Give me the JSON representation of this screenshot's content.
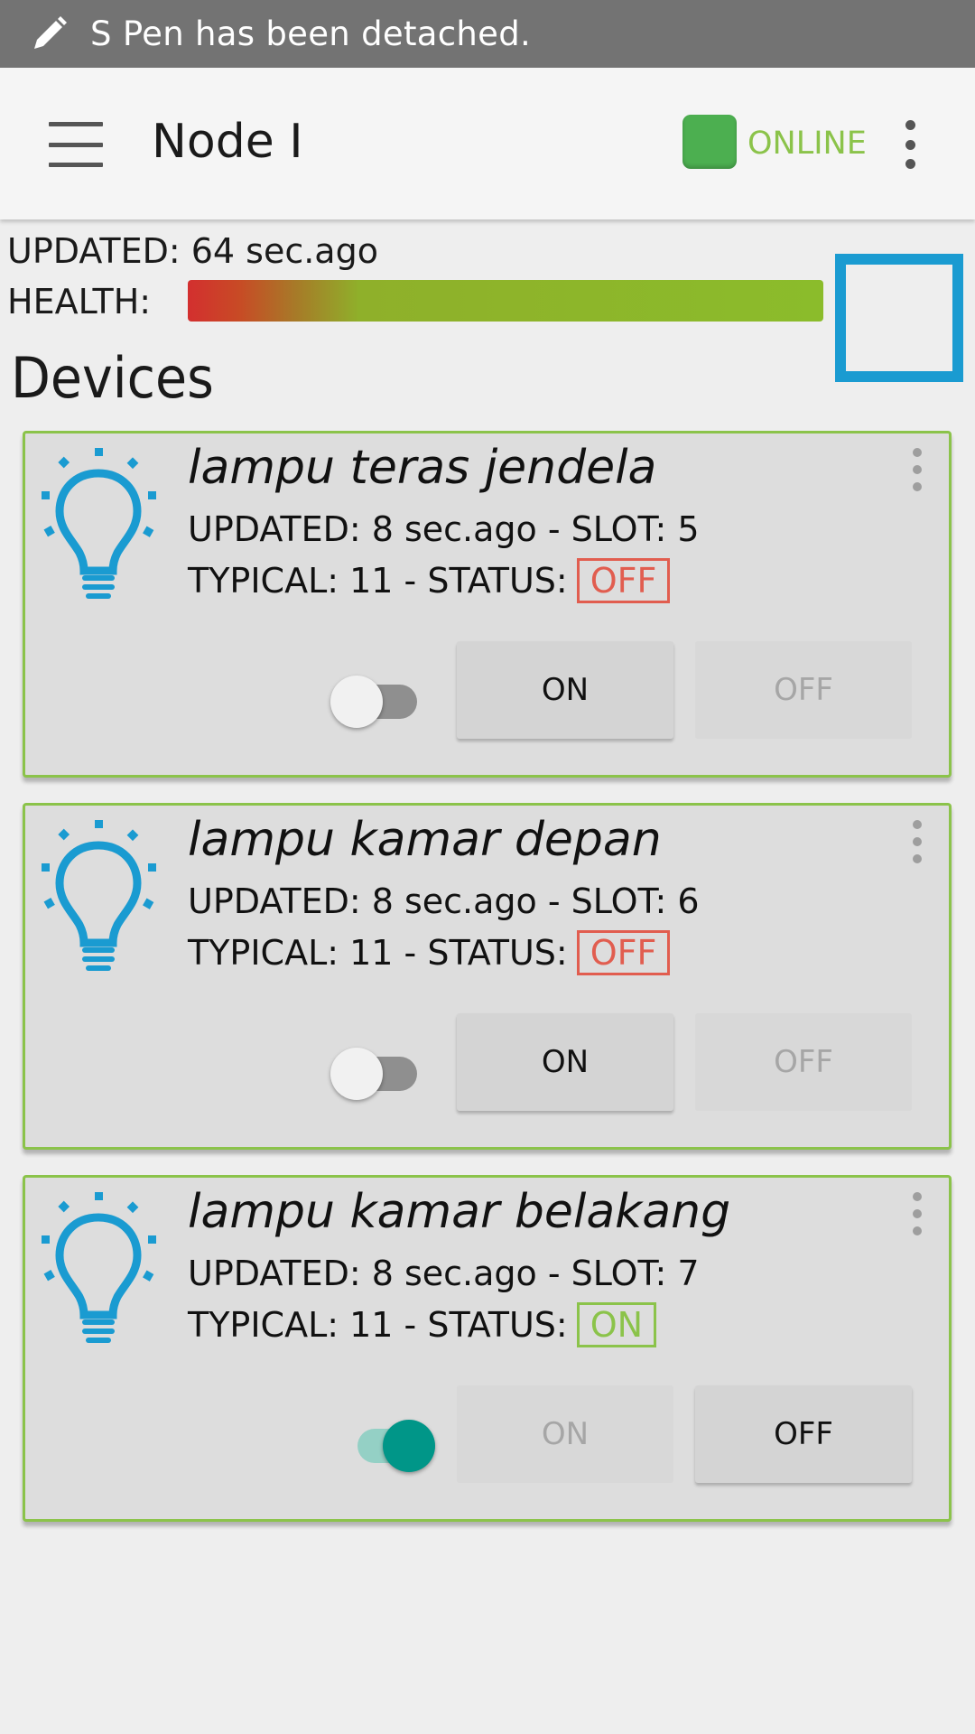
{
  "status_bar": {
    "message": "S Pen has been detached.",
    "icon": "pen-icon"
  },
  "app_bar": {
    "title": "Node I",
    "status_text": "ONLINE",
    "status_color": "#8bc34a",
    "status_indicator_color": "#4caf50"
  },
  "node": {
    "updated": "UPDATED: 64 sec.ago",
    "health_label": "HEALTH:"
  },
  "devices_heading": "Devices",
  "devices": [
    {
      "name": "lampu teras jendela",
      "updated_slot": "UPDATED: 8 sec.ago - SLOT: 5",
      "typical_status": "TYPICAL: 11 - STATUS:",
      "status": "OFF",
      "switch_on": false,
      "on_label": "ON",
      "off_label": "OFF"
    },
    {
      "name": "lampu kamar depan",
      "updated_slot": "UPDATED: 8 sec.ago - SLOT: 6",
      "typical_status": "TYPICAL: 11 - STATUS:",
      "status": "OFF",
      "switch_on": false,
      "on_label": "ON",
      "off_label": "OFF"
    },
    {
      "name": "lampu kamar belakang",
      "updated_slot": "UPDATED: 8 sec.ago - SLOT: 7",
      "typical_status": "TYPICAL: 11 - STATUS:",
      "status": "ON",
      "switch_on": true,
      "on_label": "ON",
      "off_label": "OFF"
    }
  ],
  "colors": {
    "accent_blue": "#1a9bd1",
    "card_border": "#8bc34a",
    "status_off": "#e15d4f",
    "status_on": "#8bc34a",
    "switch_on": "#009688"
  }
}
